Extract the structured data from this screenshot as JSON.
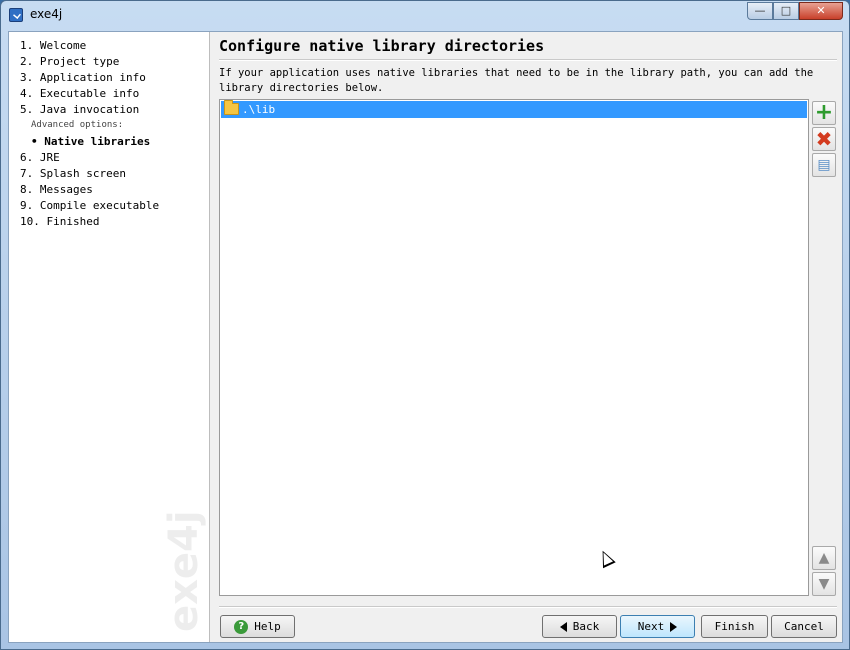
{
  "window": {
    "title": "exe4j",
    "minimize_label": "—",
    "maximize_label": "□",
    "close_label": "✕"
  },
  "sidebar": {
    "steps": [
      "1. Welcome",
      "2. Project type",
      "3. Application info",
      "4. Executable info",
      "5. Java invocation"
    ],
    "advanced_label": "Advanced options:",
    "active_step": "• Native libraries",
    "steps_after": [
      "6. JRE",
      "7. Splash screen",
      "8. Messages",
      "9. Compile executable",
      "10. Finished"
    ],
    "watermark": "exe4j"
  },
  "main": {
    "heading": "Configure native library directories",
    "description": "If your application uses native libraries that need to be in the library path, you can add the library directories below.",
    "list_items": [
      ".\\lib"
    ]
  },
  "toolbar": {
    "add_icon": "plus-icon",
    "remove_icon": "delete-icon",
    "edit_icon": "edit-icon",
    "up_icon": "arrow-up-icon",
    "down_icon": "arrow-down-icon"
  },
  "buttons": {
    "help": "Help",
    "back": "Back",
    "next": "Next",
    "finish": "Finish",
    "cancel": "Cancel"
  }
}
